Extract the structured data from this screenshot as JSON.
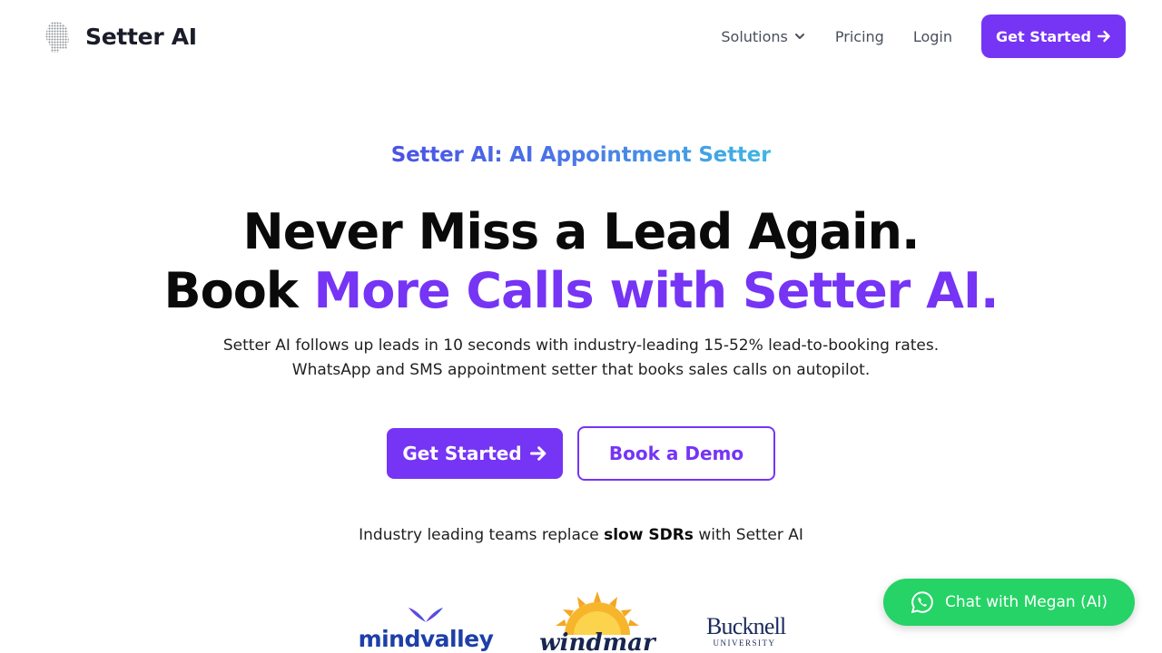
{
  "nav": {
    "brand": "Setter AI",
    "links": [
      "Solutions",
      "Pricing",
      "Login"
    ],
    "cta_label": "Get Started",
    "icons": {
      "solutions": "chevron-down-icon",
      "cta": "arrow-right-icon",
      "brand": "head-logo-icon"
    }
  },
  "hero": {
    "eyebrow": "Setter AI: AI Appointment Setter",
    "headline_line1": "Never Miss a Lead Again.",
    "headline_line2_plain": "Book ",
    "headline_line2_accent": "More Calls with Setter AI.",
    "sub_line1": "Setter AI follows up leads in 10 seconds with industry-leading 15-52% lead-to-booking rates.",
    "sub_line2": "WhatsApp and SMS appointment setter that books sales calls on autopilot.",
    "primary_cta": "Get Started",
    "secondary_cta": "Book a Demo"
  },
  "trust": {
    "prefix": "Industry leading teams replace ",
    "bold": "slow SDRs",
    "suffix": " with Setter AI"
  },
  "logos": {
    "mindvalley": "mindvalley",
    "windmar": "windmar",
    "bucknell_name": "Bucknell",
    "bucknell_sub": "UNIVERSITY"
  },
  "chat": {
    "label": "Chat with Megan (AI)",
    "icon": "whatsapp-icon"
  },
  "colors": {
    "accent": "#7634f5",
    "chat_green": "#25d366",
    "eyebrow_start": "#4a52e6",
    "eyebrow_end": "#3fb7e3"
  }
}
